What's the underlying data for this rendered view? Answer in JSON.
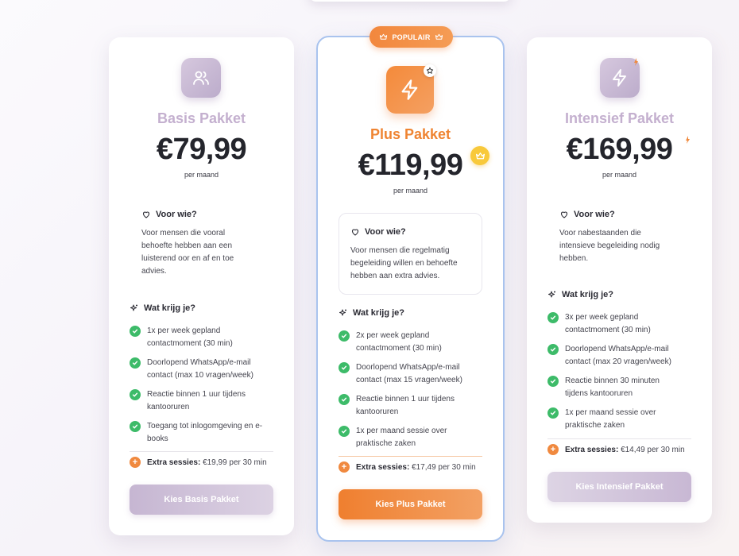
{
  "badge": {
    "label": "POPULAIR"
  },
  "plans": [
    {
      "title": "Basis Pakket",
      "price": "€79,99",
      "period": "per maand",
      "voor_heading": "Voor wie?",
      "voor_text": [
        "Voor mensen die vooral",
        "behoefte hebben aan een",
        "luisterend oor en af en toe",
        "advies."
      ],
      "wat_heading": "Wat krijg je?",
      "features": [
        [
          "1x per week gepland",
          "contactmoment (30 min)"
        ],
        [
          "Doorlopend WhatsApp/e-mail",
          "contact (max 10 vragen/week)"
        ],
        [
          "Reactie binnen 1 uur tijdens",
          "kantooruren"
        ],
        [
          "Toegang tot inlogomgeving en e-",
          "books"
        ]
      ],
      "extra_label": "Extra sessies:",
      "extra_value": "€19,99 per 30 min",
      "cta": "Kies Basis Pakket"
    },
    {
      "title": "Plus Pakket",
      "price": "€119,99",
      "period": "per maand",
      "voor_heading": "Voor wie?",
      "voor_text": [
        "Voor mensen die regelmatig",
        "begeleiding willen en behoefte",
        "hebben aan extra advies."
      ],
      "wat_heading": "Wat krijg je?",
      "features": [
        [
          "2x per week gepland",
          "contactmoment (30 min)"
        ],
        [
          "Doorlopend WhatsApp/e-mail",
          "contact (max 15 vragen/week)"
        ],
        [
          "Reactie binnen 1 uur tijdens",
          "kantooruren"
        ],
        [
          "1x per maand sessie over",
          "praktische zaken"
        ]
      ],
      "extra_label": "Extra sessies:",
      "extra_value": "€17,49 per 30 min",
      "cta": "Kies Plus Pakket"
    },
    {
      "title": "Intensief Pakket",
      "price": "€169,99",
      "period": "per maand",
      "voor_heading": "Voor wie?",
      "voor_text": [
        "Voor nabestaanden die",
        "intensieve begeleiding nodig",
        "hebben."
      ],
      "wat_heading": "Wat krijg je?",
      "features": [
        [
          "3x per week gepland",
          "contactmoment (30 min)"
        ],
        [
          "Doorlopend WhatsApp/e-mail",
          "contact (max 20 vragen/week)"
        ],
        [
          "Reactie binnen 30 minuten",
          "tijdens kantooruren"
        ],
        [
          "1x per maand sessie over",
          "praktische zaken"
        ]
      ],
      "extra_label": "Extra sessies:",
      "extra_value": "€14,49 per 30 min",
      "cta": "Kies Intensief Pakket"
    }
  ],
  "icons": {
    "basis": "users-icon",
    "plus": "lightning-icon",
    "intensief": "lightning-icon",
    "voor": "heart-icon",
    "wat": "sparkles-icon",
    "feature": "check-circle-icon",
    "extra": "plus-circle-icon"
  },
  "colors": {
    "lilac": "#c4b0cf",
    "orange": "#ef8432",
    "check_green": "#3dbb69",
    "highlight_border": "#a9c3ee",
    "crown_yellow": "#f8c93b"
  }
}
